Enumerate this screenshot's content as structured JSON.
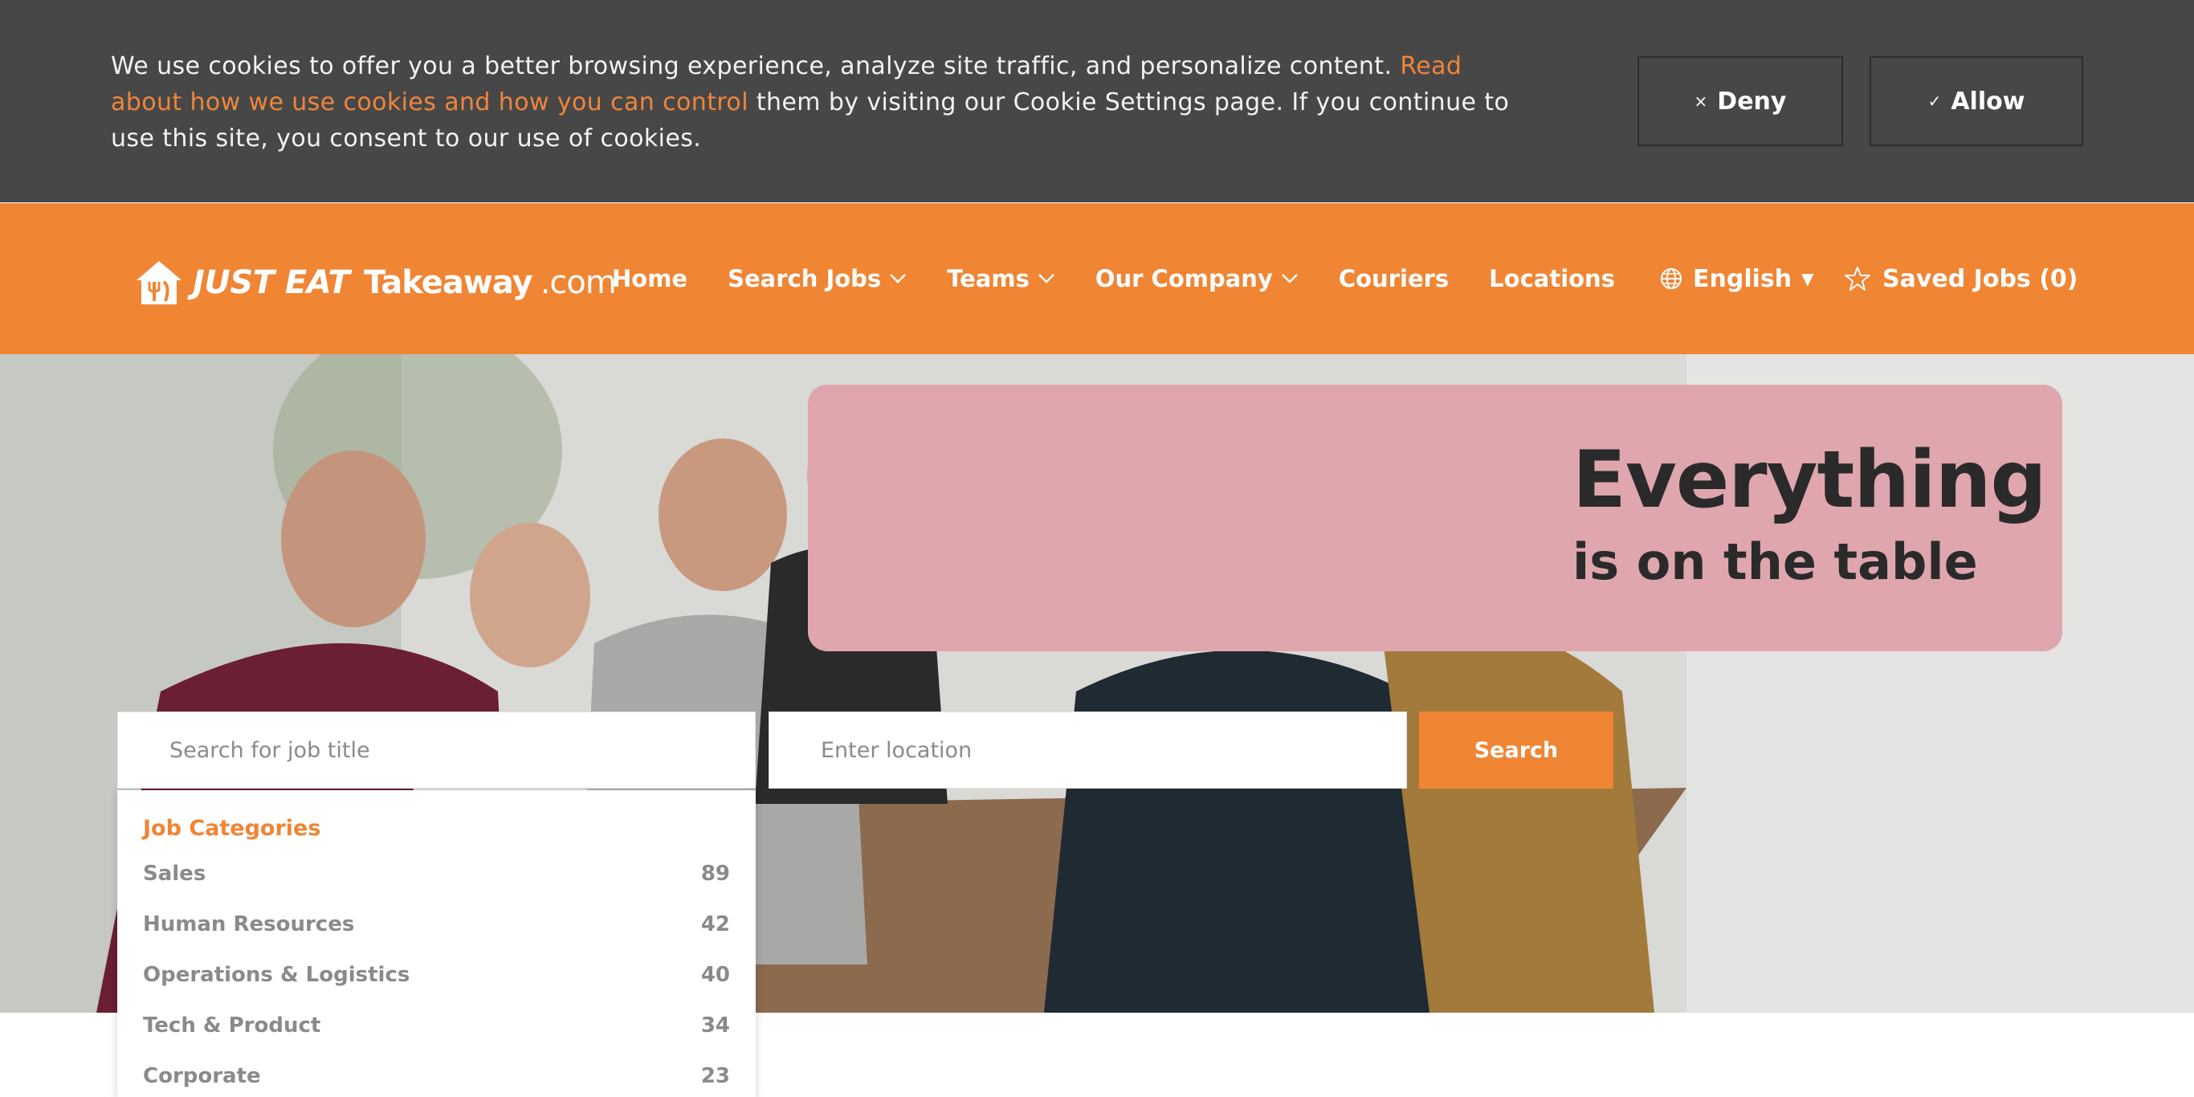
{
  "cookie_banner": {
    "text_before": "We use cookies to offer you a better browsing experience, analyze site traffic, and personalize content. ",
    "link_text": "Read about how we use cookies and how you can control",
    "text_after": " them by visiting our Cookie Settings page. If you continue to use this site, you consent to our use of cookies.",
    "deny_icon": "×",
    "deny_label": "Deny",
    "allow_icon": "✓",
    "allow_label": "Allow"
  },
  "header": {
    "logo": {
      "part1": "JUST EAT",
      "part2": "Takeaway",
      "part3": ".com"
    },
    "nav": [
      {
        "label": "Home"
      },
      {
        "label": "Search Jobs"
      },
      {
        "label": "Teams"
      },
      {
        "label": "Our Company"
      },
      {
        "label": "Couriers"
      },
      {
        "label": "Locations"
      }
    ],
    "language": {
      "label": "English",
      "caret": "▼",
      "icon": "globe-icon"
    },
    "saved_jobs": {
      "label": "Saved Jobs (0)",
      "icon": "star-icon"
    }
  },
  "hero": {
    "slogan_line1": "Everything",
    "slogan_line2": "is on the table"
  },
  "search": {
    "job_placeholder": "Search for job title",
    "location_placeholder": "Enter location",
    "button_label": "Search"
  },
  "job_categories": {
    "title": "Job Categories",
    "items": [
      {
        "name": "Sales",
        "count": "89"
      },
      {
        "name": "Human Resources",
        "count": "42"
      },
      {
        "name": "Operations & Logistics",
        "count": "40"
      },
      {
        "name": "Tech & Product",
        "count": "34"
      },
      {
        "name": "Corporate",
        "count": "23"
      }
    ]
  },
  "colors": {
    "brand_orange": "#f08534",
    "cookie_bg": "#474747",
    "banner_pink": "#dfa6ad"
  }
}
